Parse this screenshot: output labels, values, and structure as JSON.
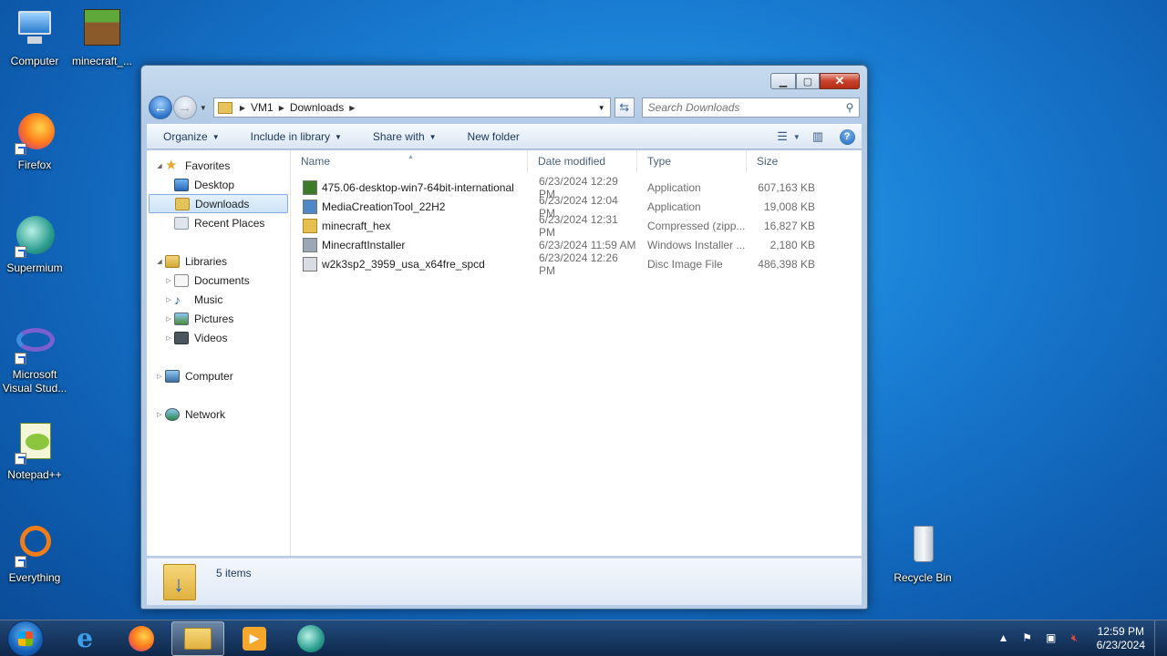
{
  "desktop": {
    "icons": [
      {
        "label": "Computer"
      },
      {
        "label": "minecraft_..."
      },
      {
        "label": "Firefox"
      },
      {
        "label": "Supermium"
      },
      {
        "label": "Microsoft Visual Stud..."
      },
      {
        "label": "Notepad++"
      },
      {
        "label": "Everything"
      },
      {
        "label": "Recycle Bin"
      }
    ]
  },
  "window": {
    "address": {
      "crumbs": [
        "VM1",
        "Downloads"
      ]
    },
    "search": {
      "placeholder": "Search Downloads"
    },
    "toolbar": {
      "organize": "Organize",
      "include": "Include in library",
      "share": "Share with",
      "new_folder": "New folder"
    },
    "nav": {
      "favorites": "Favorites",
      "desktop": "Desktop",
      "downloads": "Downloads",
      "recent": "Recent Places",
      "libraries": "Libraries",
      "documents": "Documents",
      "music": "Music",
      "pictures": "Pictures",
      "videos": "Videos",
      "computer": "Computer",
      "network": "Network"
    },
    "columns": {
      "name": "Name",
      "date": "Date modified",
      "type": "Type",
      "size": "Size"
    },
    "files": [
      {
        "name": "475.06-desktop-win7-64bit-international",
        "date": "6/23/2024 12:29 PM",
        "type": "Application",
        "size": "607,163 KB",
        "color": "#3d7a2a"
      },
      {
        "name": "MediaCreationTool_22H2",
        "date": "6/23/2024 12:04 PM",
        "type": "Application",
        "size": "19,008 KB",
        "color": "#4f88c6"
      },
      {
        "name": "minecraft_hex",
        "date": "6/23/2024 12:31 PM",
        "type": "Compressed (zipp...",
        "size": "16,827 KB",
        "color": "#e6bf4e"
      },
      {
        "name": "MinecraftInstaller",
        "date": "6/23/2024 11:59 AM",
        "type": "Windows Installer ...",
        "size": "2,180 KB",
        "color": "#9aa7b4"
      },
      {
        "name": "w2k3sp2_3959_usa_x64fre_spcd",
        "date": "6/23/2024 12:26 PM",
        "type": "Disc Image File",
        "size": "486,398 KB",
        "color": "#d9dde3"
      }
    ],
    "status": {
      "count": "5 items"
    }
  },
  "taskbar": {
    "clock_time": "12:59 PM",
    "clock_date": "6/23/2024"
  }
}
